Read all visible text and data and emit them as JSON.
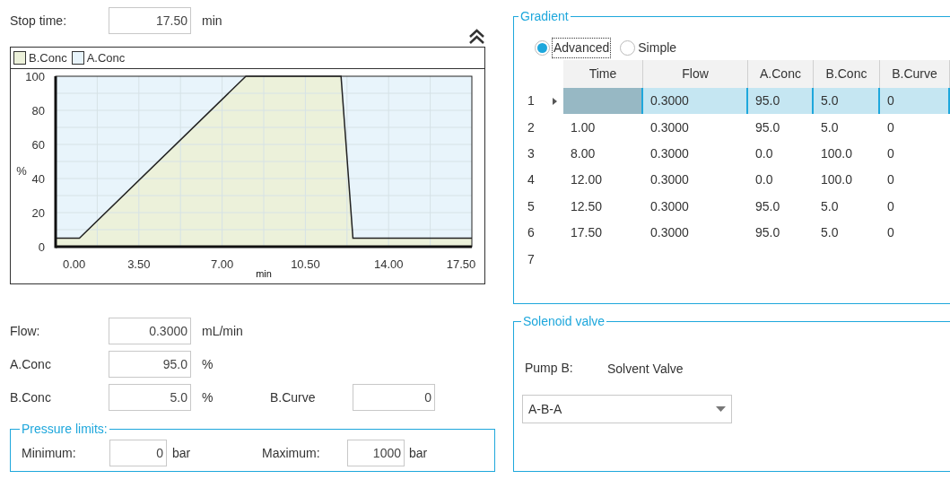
{
  "stop_time": {
    "label": "Stop time:",
    "value": "17.50",
    "unit": "min"
  },
  "chart": {
    "chart_data": {
      "type": "area",
      "stacked": true,
      "grid": true,
      "xlabel": "min",
      "ylabel": "%",
      "x": [
        0,
        1,
        8,
        12,
        12.5,
        17.5
      ],
      "series": [
        {
          "name": "B.Conc",
          "color": "#ecf1da",
          "values": [
            5,
            5,
            100,
            100,
            5,
            5
          ]
        },
        {
          "name": "A.Conc",
          "color": "#e8f4fb",
          "values": [
            95,
            95,
            0,
            0,
            95,
            95
          ]
        }
      ],
      "xlim": [
        0,
        17.5
      ],
      "ylim": [
        0,
        100
      ],
      "xticks": [
        {
          "value": 0,
          "label": "0.00"
        },
        {
          "value": 3.5,
          "label": "3.50"
        },
        {
          "value": 7,
          "label": "7.00"
        },
        {
          "value": 10.5,
          "label": "10.50"
        },
        {
          "value": 14,
          "label": "14.00"
        },
        {
          "value": 17.5,
          "label": "17.50"
        }
      ],
      "yticks": [
        0,
        20,
        40,
        60,
        80,
        100
      ]
    }
  },
  "parameters": [
    {
      "label": "Flow:",
      "value": "0.3000",
      "unit": "mL/min"
    },
    {
      "label": "A.Conc",
      "value": "95.0",
      "unit": "%"
    },
    {
      "label": "B.Conc",
      "value": "5.0",
      "unit": "%"
    }
  ],
  "b_curve": {
    "label": "B.Curve",
    "value": "0"
  },
  "pressure_limits": {
    "title": "Pressure limits:",
    "minimum": {
      "label": "Minimum:",
      "value": "0",
      "unit": "bar"
    },
    "maximum": {
      "label": "Maximum:",
      "value": "1000",
      "unit": "bar"
    }
  },
  "gradient": {
    "title": "Gradient",
    "modes": [
      {
        "label": "Advanced",
        "selected": true
      },
      {
        "label": "Simple",
        "selected": false
      }
    ],
    "table": {
      "columns": [
        "Time",
        "Flow",
        "A.Conc",
        "B.Conc",
        "B.Curve"
      ],
      "rows": [
        {
          "number": "1",
          "selected": true,
          "cells": [
            null,
            "0.3000",
            "95.0",
            "5.0",
            "0"
          ]
        },
        {
          "number": "2",
          "selected": false,
          "cells": [
            "1.00",
            "0.3000",
            "95.0",
            "5.0",
            "0"
          ]
        },
        {
          "number": "3",
          "selected": false,
          "cells": [
            "8.00",
            "0.3000",
            "0.0",
            "100.0",
            "0"
          ]
        },
        {
          "number": "4",
          "selected": false,
          "cells": [
            "12.00",
            "0.3000",
            "0.0",
            "100.0",
            "0"
          ]
        },
        {
          "number": "5",
          "selected": false,
          "cells": [
            "12.50",
            "0.3000",
            "95.0",
            "5.0",
            "0"
          ]
        },
        {
          "number": "6",
          "selected": false,
          "cells": [
            "17.50",
            "0.3000",
            "95.0",
            "5.0",
            "0"
          ]
        },
        {
          "number": "7",
          "selected": false
        }
      ]
    }
  },
  "solenoid_valve": {
    "title": "Solenoid valve",
    "pump_label": "Pump B:",
    "pump_value": "Solvent Valve",
    "dropdown": {
      "value": "A-B-A"
    }
  }
}
